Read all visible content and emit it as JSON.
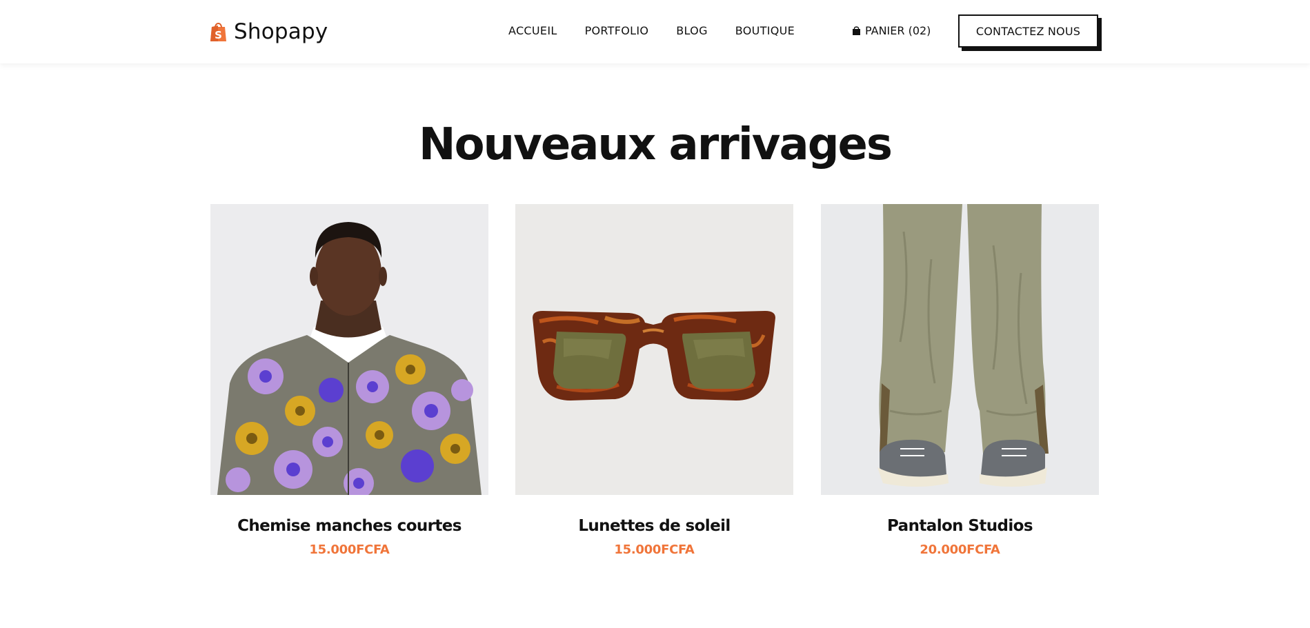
{
  "header": {
    "brand": "Shopapy",
    "nav": [
      "ACCUEIL",
      "PORTFOLIO",
      "BLOG",
      "BOUTIQUE"
    ],
    "cart_label": "PANIER (02)",
    "contact_label": "CONTACTEZ NOUS"
  },
  "section": {
    "title": "Nouveaux arrivages"
  },
  "products": [
    {
      "name": "Chemise manches courtes",
      "price": "15.000FCFA",
      "image": "floral-shirt-model"
    },
    {
      "name": "Lunettes de soleil",
      "price": "15.000FCFA",
      "image": "tortoise-sunglasses"
    },
    {
      "name": "Pantalon Studios",
      "price": "20.000FCFA",
      "image": "khaki-pants-sneakers"
    }
  ],
  "colors": {
    "accent": "#f0753a",
    "brand_icon": "#f0753a",
    "text": "#111111"
  }
}
